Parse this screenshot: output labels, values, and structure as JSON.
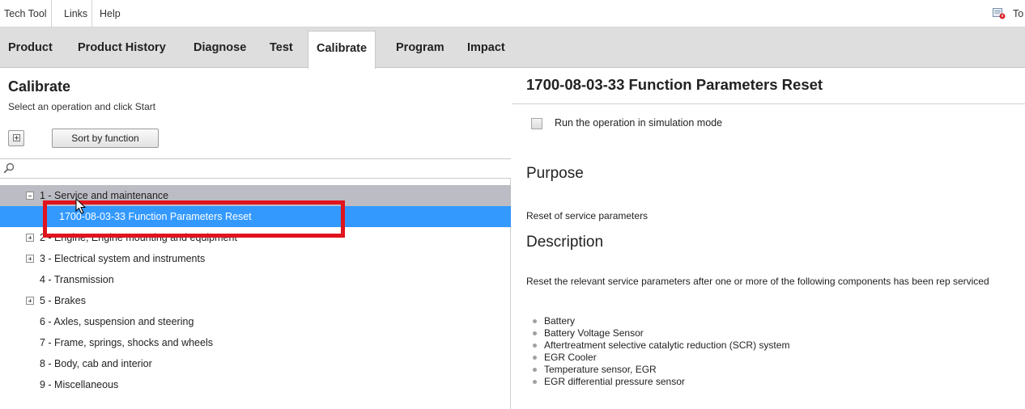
{
  "menu": {
    "items": [
      "Tech Tool",
      "Links",
      "Help"
    ],
    "right_label": "To"
  },
  "tabs": [
    {
      "label": "Product",
      "active": false
    },
    {
      "label": "Product History",
      "active": false
    },
    {
      "label": "Diagnose",
      "active": false
    },
    {
      "label": "Test",
      "active": false
    },
    {
      "label": "Calibrate",
      "active": true
    },
    {
      "label": "Program",
      "active": false
    },
    {
      "label": "Impact",
      "active": false
    }
  ],
  "left": {
    "title": "Calibrate",
    "subtitle": "Select an operation and click Start",
    "sort_label": "Sort by function",
    "search_value": "",
    "tree": [
      {
        "label": "1 - Service and maintenance",
        "toggle": "minus",
        "state": "group-open"
      },
      {
        "label": "1700-08-03-33 Function Parameters Reset",
        "toggle": "none",
        "state": "selected"
      },
      {
        "label": "2 - Engine, Engine mounting and equipment",
        "toggle": "plus",
        "state": ""
      },
      {
        "label": "3 - Electrical system and instruments",
        "toggle": "plus",
        "state": ""
      },
      {
        "label": "4 - Transmission",
        "toggle": "none",
        "state": ""
      },
      {
        "label": "5 - Brakes",
        "toggle": "plus",
        "state": ""
      },
      {
        "label": "6 - Axles, suspension and steering",
        "toggle": "none",
        "state": ""
      },
      {
        "label": "7 - Frame, springs, shocks and wheels",
        "toggle": "none",
        "state": ""
      },
      {
        "label": "8 - Body, cab and interior",
        "toggle": "none",
        "state": ""
      },
      {
        "label": "9 - Miscellaneous",
        "toggle": "none",
        "state": ""
      }
    ]
  },
  "right": {
    "title": "1700-08-03-33 Function Parameters Reset",
    "simulation_label": "Run the operation in simulation mode",
    "simulation_checked": false,
    "purpose_heading": "Purpose",
    "purpose_text": "Reset of service parameters",
    "description_heading": "Description",
    "description_text": "Reset the relevant service parameters after one or more of the following components has been rep serviced",
    "components": [
      "Battery",
      "Battery Voltage Sensor",
      "Aftertreatment selective catalytic reduction (SCR) system",
      "EGR Cooler",
      "Temperature sensor, EGR",
      "EGR differential pressure sensor"
    ]
  },
  "colors": {
    "selection": "#3399ff",
    "callout": "#e0141e",
    "tabbar": "#dedede",
    "group_row": "#bcbcc4"
  }
}
